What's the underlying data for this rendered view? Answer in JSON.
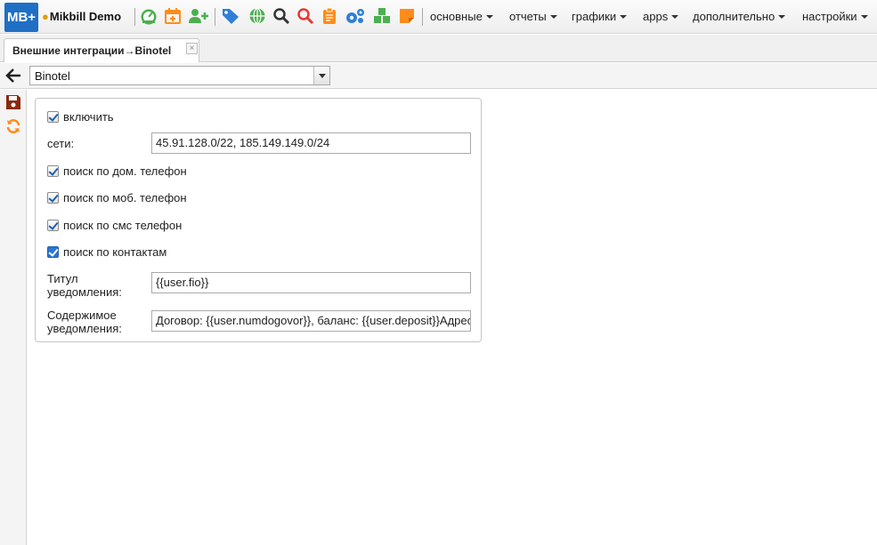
{
  "topbar": {
    "logo": "MB+",
    "brand": "Mikbill Demo",
    "menus": [
      {
        "label": "основные"
      },
      {
        "label": "отчеты"
      },
      {
        "label": "графики"
      },
      {
        "label": "apps"
      },
      {
        "label": "дополнительно"
      },
      {
        "label": "настройки"
      }
    ],
    "icons": [
      "dashboard-icon",
      "calendar-add-icon",
      "add-user-icon",
      "tags-icon",
      "globe-icon",
      "search-icon",
      "search-red-icon",
      "clipboard-icon",
      "cogs-icon",
      "cubes-icon",
      "sticky-note-icon"
    ]
  },
  "tab": {
    "label": "Внешние интеграции→Binotel",
    "close": "×"
  },
  "toolbar": {
    "selected": "Binotel"
  },
  "form": {
    "enable": {
      "label": "включить",
      "checked": true
    },
    "networks": {
      "label": "сети:",
      "value": "45.91.128.0/22, 185.149.149.0/24"
    },
    "search_home": {
      "label": "поиск по дом. телефон",
      "checked": true
    },
    "search_mobile": {
      "label": "поиск по моб. телефон",
      "checked": true
    },
    "search_sms": {
      "label": "поиск по смс телефон",
      "checked": true
    },
    "search_contacts": {
      "label": "поиск по контактам",
      "checked": true
    },
    "notify_title": {
      "label_line1": "Титул",
      "label_line2": "уведомления:",
      "value": "{{user.fio}}"
    },
    "notify_body": {
      "label_line1": "Содержимое",
      "label_line2": "уведомления:",
      "value": "Договор: {{user.numdogovor}}, баланс: {{user.deposit}}Адрес"
    }
  },
  "colors": {
    "logo": "#1f6fc5",
    "green_icon": "#4caf50",
    "orange_icon": "#ff8c1a",
    "blue_icon": "#2f7fd6",
    "red_icon": "#e53935",
    "save_icon": "#8b2a0f"
  }
}
